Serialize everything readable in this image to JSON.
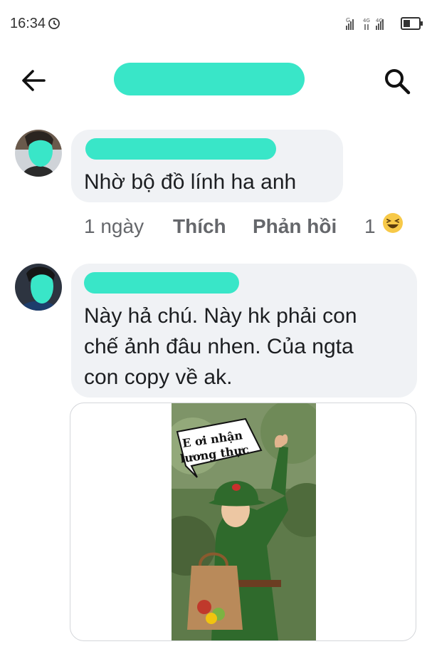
{
  "status_bar": {
    "time": "16:34",
    "icons": [
      "alarm-icon",
      "signal-icon",
      "4g-icon",
      "battery-icon"
    ]
  },
  "header": {
    "back_icon": "arrow-left-icon",
    "search_icon": "search-icon"
  },
  "comments": [
    {
      "text": "Nhờ bộ đồ lính ha anh",
      "actions": {
        "time": "1 ngày",
        "like": "Thích",
        "reply": "Phản hồi",
        "reaction_count": "1",
        "reaction_icon": "haha-emoji-icon"
      }
    },
    {
      "text_lines": [
        "Này hả chú. Này hk phải con",
        "chế ảnh đâu nhen. Của ngta",
        "con copy về ak."
      ],
      "attachment": {
        "caption_line1": "E ơi nhận",
        "caption_line2": "lương thực"
      }
    }
  ],
  "colors": {
    "redaction": "#39e6c8",
    "bubble": "#f0f2f5",
    "secondary_text": "#65676b"
  }
}
